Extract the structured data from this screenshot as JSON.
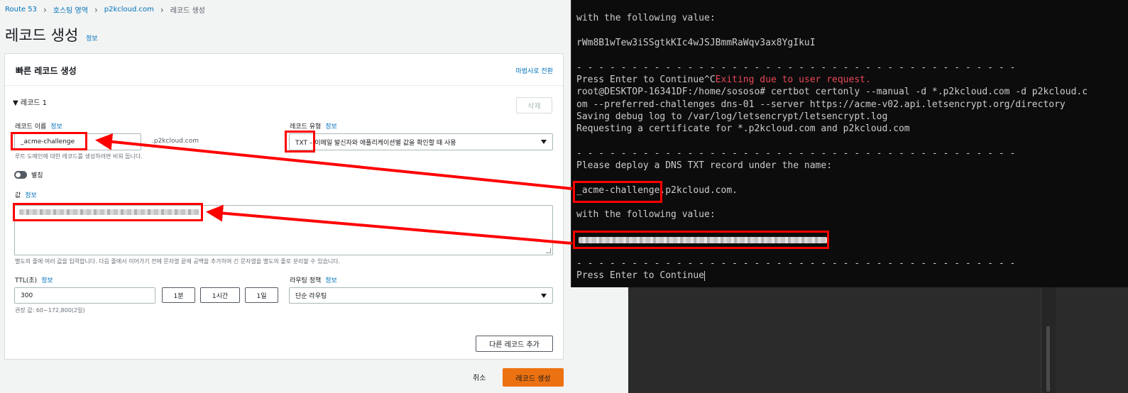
{
  "breadcrumb": {
    "items": [
      "Route 53",
      "호스팅 영역",
      "p2kcloud.com"
    ],
    "current": "레코드 생성"
  },
  "page": {
    "title": "레코드 생성",
    "info": "정보"
  },
  "panel": {
    "title": "빠른 레코드 생성",
    "wizard_link": "마법사로 전환",
    "record_section": "▼ 레코드 1",
    "delete_label": "삭제",
    "record_name": {
      "label": "레코드 이름",
      "info": "정보",
      "value": "_acme-challenge",
      "suffix": ".p2kcloud.com",
      "hint": "루트 도메인에 대한 레코드를 생성하려면 비워 둡니다."
    },
    "record_type": {
      "label": "레코드 유형",
      "info": "정보",
      "value": "TXT – 이메일 발신자와 애플리케이션별 값을 확인할 때 사용"
    },
    "alias": {
      "label": "별칭",
      "enabled": false
    },
    "value": {
      "label": "값",
      "info": "정보",
      "hint": "별도의 줄에 여러 값을 입력합니다. 다음 줄에서 이어가기 전에 문자열 끝에 공백을 추가하여 긴 문자열을 별도의 줄로 분리할 수 있습니다."
    },
    "ttl": {
      "label": "TTL(초)",
      "info": "정보",
      "value": "300",
      "buttons": [
        "1분",
        "1시간",
        "1일"
      ],
      "hint": "권장 값: 60~172,800(2일)"
    },
    "routing": {
      "label": "라우팅 정책",
      "info": "정보",
      "value": "단순 라우팅"
    },
    "add_record_label": "다른 레코드 추가"
  },
  "footer": {
    "cancel_label": "취소",
    "create_label": "레코드 생성"
  },
  "terminal": {
    "line1": "with the following value:",
    "line2": "rWm8B1wTew3iSSgtkKIc4wJSJBmmRaWqv3ax8YgIkuI",
    "dash": "- - - - - - - - - - - - - - - - - - - - - - - - - - - - - - - - - - - - - - - -",
    "line4a": "Press Enter to Continue^C",
    "line4b": "Exiting due to user request.",
    "line5": "root@DESKTOP-16341DF:/home/sososo# certbot certonly --manual -d *.p2kcloud.com -d p2kcloud.c",
    "line6": "om --preferred-challenges dns-01 --server https://acme-v02.api.letsencrypt.org/directory",
    "line7": "Saving debug log to /var/log/letsencrypt/letsencrypt.log",
    "line8": "Requesting a certificate for *.p2kcloud.com and p2kcloud.com",
    "line10": "Please deploy a DNS TXT record under the name:",
    "line11a": "_acme-challenge",
    "line11b": ".p2kcloud.com.",
    "line12": "with the following value:",
    "line15": "Press Enter to Continue"
  },
  "colors": {
    "annotation": "#ff0000",
    "primary_button": "#ec7211",
    "link": "#0073bb",
    "terminal_bg": "#0c0c0c",
    "terminal_error": "#e74856"
  }
}
